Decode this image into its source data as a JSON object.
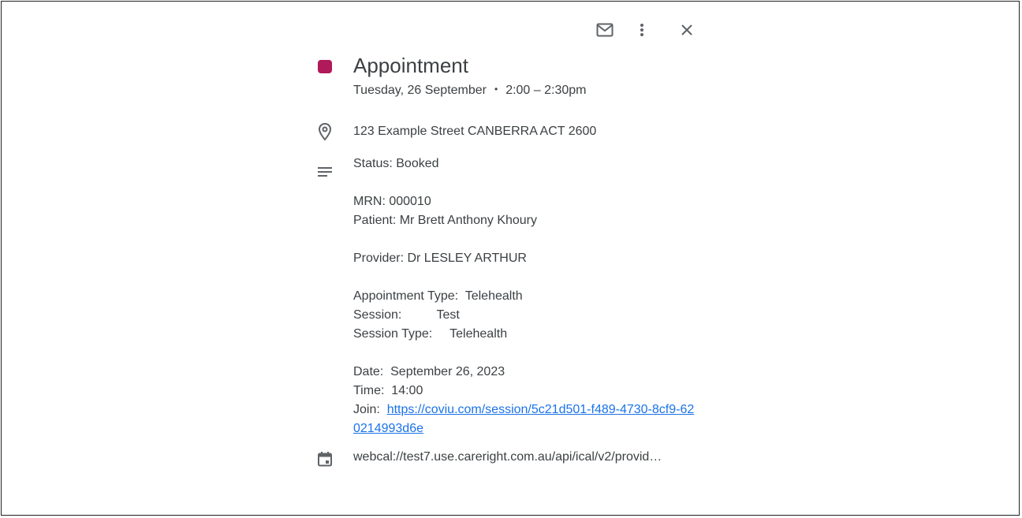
{
  "toolbar": {
    "email_icon": "email-icon",
    "more_icon": "more-vert-icon",
    "close_icon": "close-icon"
  },
  "event": {
    "color": "#b0195a",
    "title": "Appointment",
    "date": "Tuesday, 26 September",
    "separator": "•",
    "time_range": "2:00 – 2:30pm",
    "location": "123 Example Street CANBERRA ACT 2600",
    "description": {
      "status": "Status: Booked",
      "mrn": "MRN: 000010",
      "patient": "Patient: Mr Brett Anthony Khoury",
      "provider": "Provider: Dr LESLEY ARTHUR",
      "appointment_type": "Appointment Type:  Telehealth",
      "session": "Session:          Test",
      "session_type": "Session Type:     Telehealth",
      "date": "Date:  September 26, 2023",
      "time": "Time:  14:00",
      "join_label": "Join:  ",
      "join_link": "https://coviu.com/session/5c21d501-f489-4730-8cf9-620214993d6e"
    },
    "calendar": "webcal://test7.use.careright.com.au/api/ical/v2/provid…"
  }
}
